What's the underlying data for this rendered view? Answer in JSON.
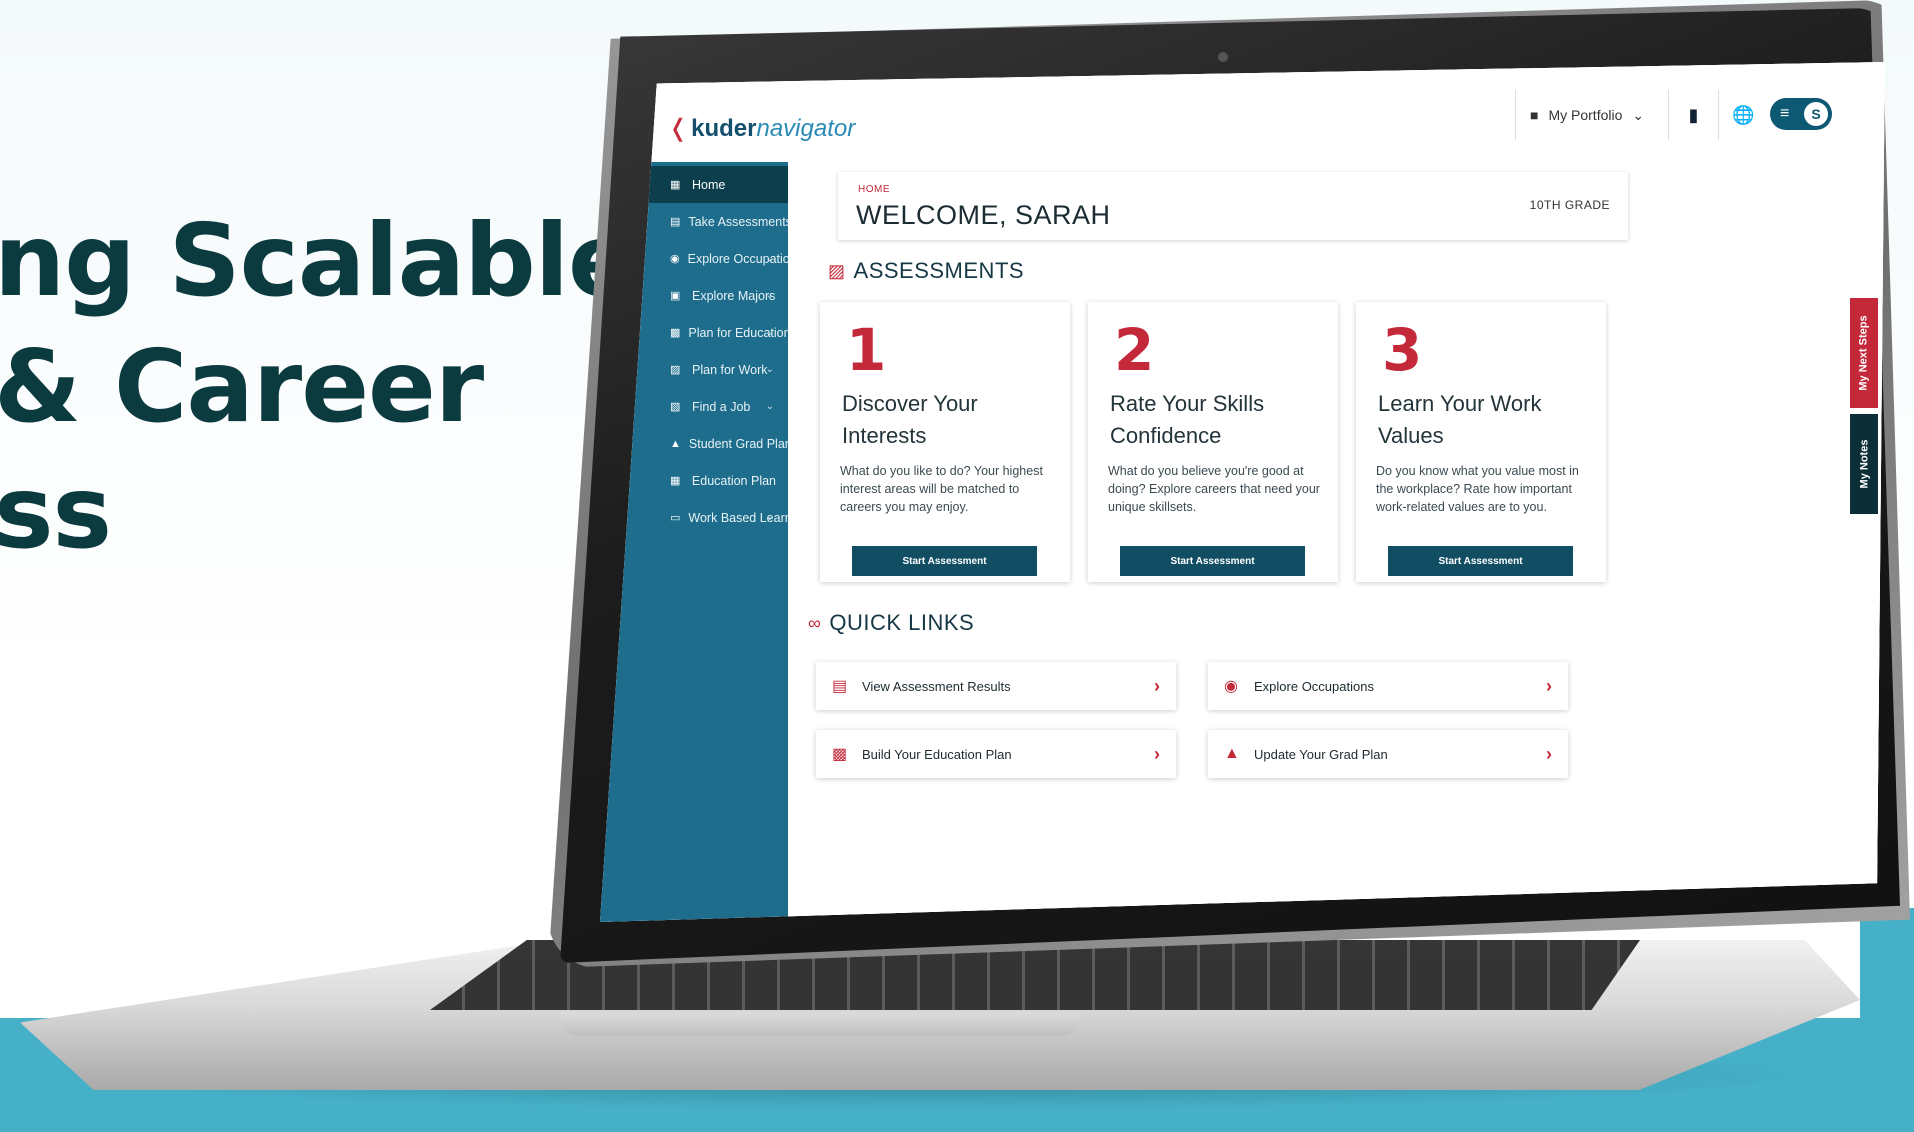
{
  "marketing": {
    "lines": [
      "ng Scalable",
      "& Career",
      "ss"
    ]
  },
  "logo": {
    "bold": "kuder",
    "light": "navigator",
    "mark": "❬"
  },
  "topbar": {
    "portfolio_label": "My Portfolio",
    "avatar_letter": "S"
  },
  "sidebar": {
    "items": [
      {
        "label": "Home"
      },
      {
        "label": "Take Assessments"
      },
      {
        "label": "Explore Occupations"
      },
      {
        "label": "Explore Majors"
      },
      {
        "label": "Plan for Education"
      },
      {
        "label": "Plan for Work"
      },
      {
        "label": "Find a Job"
      },
      {
        "label": "Student Grad Plan"
      },
      {
        "label": "Education Plan"
      },
      {
        "label": "Work Based Learning"
      }
    ]
  },
  "welcome": {
    "breadcrumb": "HOME",
    "title": "WELCOME, SARAH",
    "grade": "10TH GRADE"
  },
  "assessments": {
    "heading": "ASSESSMENTS",
    "cards": [
      {
        "num": "1",
        "title": "Discover Your Interests",
        "desc": "What do you like to do? Your highest interest areas will be matched to careers you may enjoy.",
        "button": "Start Assessment"
      },
      {
        "num": "2",
        "title": "Rate Your Skills Confidence",
        "desc": "What do you believe you're good at doing? Explore careers that need your unique skillsets.",
        "button": "Start Assessment"
      },
      {
        "num": "3",
        "title": "Learn Your Work Values",
        "desc": "Do you know what you value most in the workplace? Rate how important work-related values are to you.",
        "button": "Start Assessment"
      }
    ]
  },
  "quick_links": {
    "heading": "QUICK LINKS",
    "items": [
      {
        "label": "View Assessment Results"
      },
      {
        "label": "Explore Occupations"
      },
      {
        "label": "Build Your Education Plan"
      },
      {
        "label": "Update Your Grad Plan"
      }
    ]
  },
  "side_tabs": {
    "next_steps": "My Next Steps",
    "notes": "My Notes"
  },
  "colors": {
    "sidebar": "#1e6d8c",
    "sidebar_active": "#0c3e4d",
    "accent_red": "#c4293a",
    "button": "#114e63",
    "headline": "#0b3a3f",
    "teal_band": "#45b0c8"
  }
}
